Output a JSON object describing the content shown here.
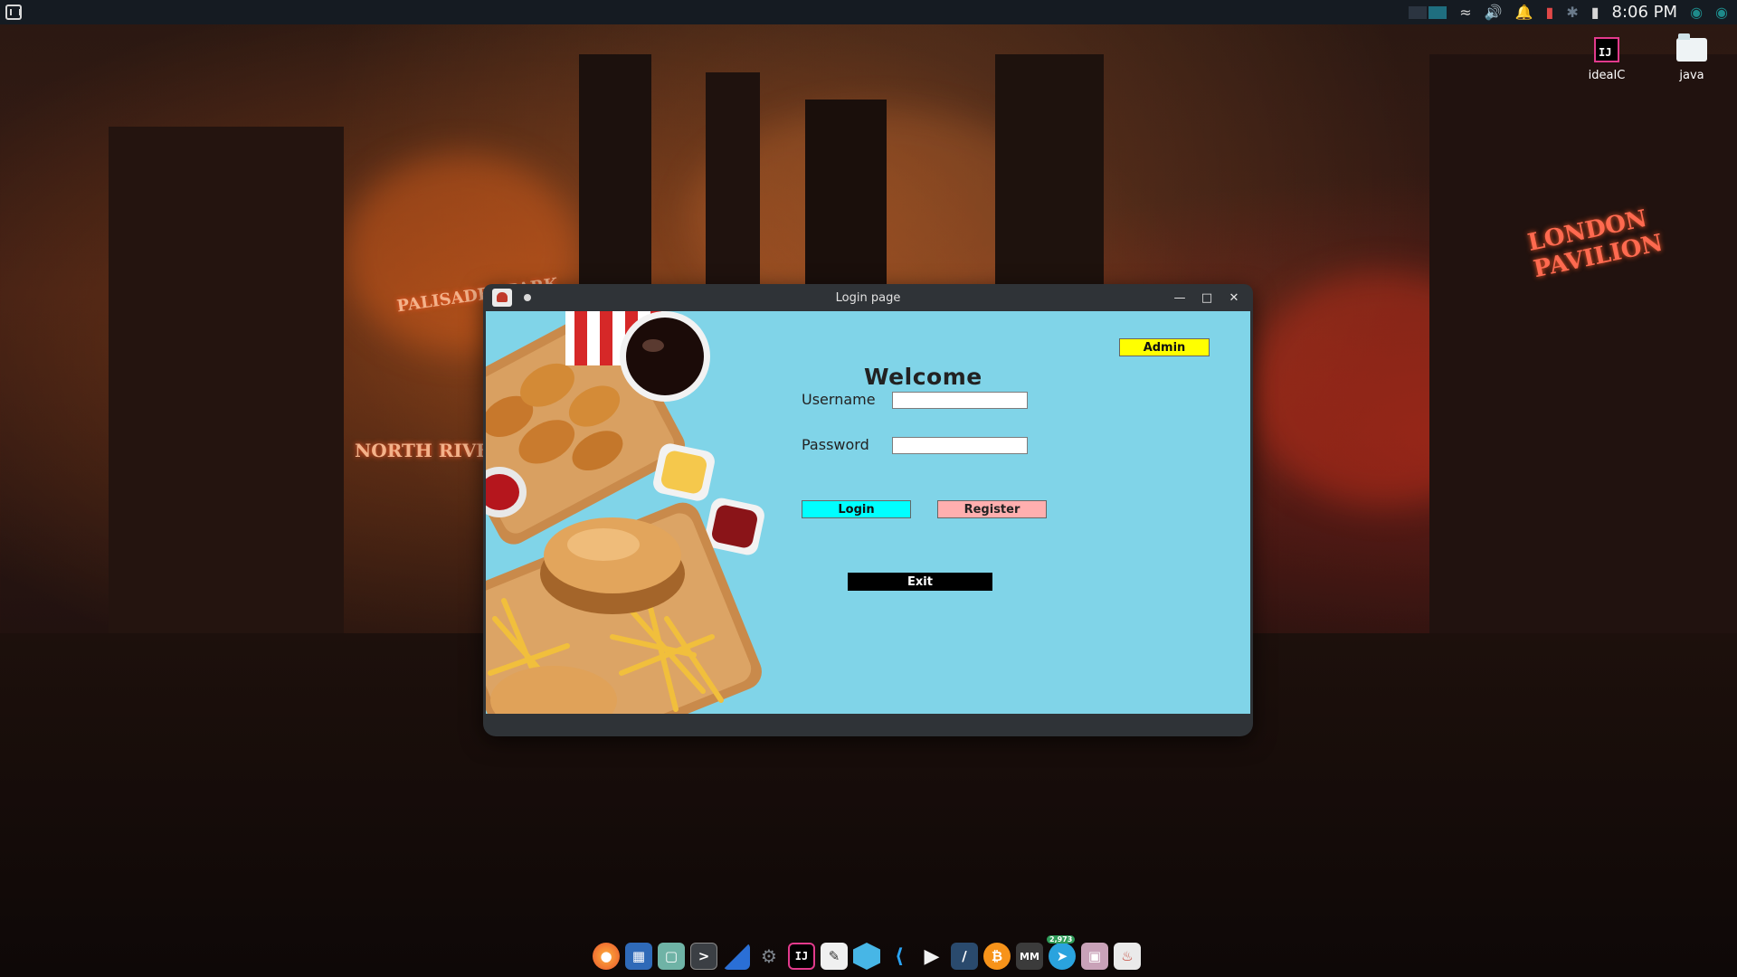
{
  "panel": {
    "clock": "8:06 PM",
    "tray_icons": [
      "wifi-icon",
      "volume-icon",
      "bell-icon",
      "battery-alert-icon",
      "bluetooth-icon",
      "battery-icon",
      "update-icon"
    ]
  },
  "desktop": {
    "icons": [
      {
        "label": "ideaIC",
        "icon": "intellij-icon"
      },
      {
        "label": "java",
        "icon": "folder-icon"
      }
    ]
  },
  "window": {
    "title": "Login page",
    "welcome": "Welcome",
    "username_label": "Username",
    "password_label": "Password",
    "username_value": "",
    "password_value": "",
    "buttons": {
      "admin": "Admin",
      "login": "Login",
      "register": "Register",
      "exit": "Exit"
    },
    "colors": {
      "background": "#80d4e8",
      "admin": "#ffff00",
      "login": "#00ffff",
      "register": "#ffafaf",
      "exit": "#000000"
    }
  },
  "dock": {
    "apps": [
      "firefox-icon",
      "file-manager-icon",
      "files-icon",
      "terminal-icon",
      "kite-icon",
      "settings-icon",
      "intellij-icon",
      "text-editor-icon",
      "package-icon",
      "vscode-icon",
      "media-player-icon",
      "network-tool-icon",
      "bitcoin-icon",
      "mm-icon",
      "telegram-icon",
      "screenshot-icon",
      "java-app-icon"
    ],
    "telegram_badge": "2,973"
  }
}
